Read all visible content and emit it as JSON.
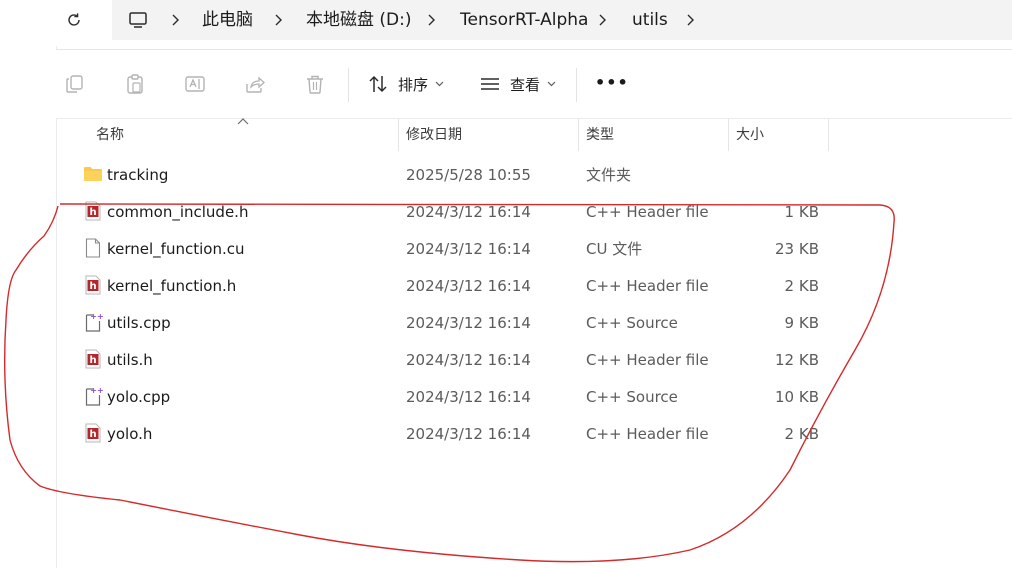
{
  "address_bar": {
    "breadcrumbs": [
      "此电脑",
      "本地磁盘 (D:)",
      "TensorRT-Alpha",
      "utils"
    ]
  },
  "toolbar": {
    "sort_label": "排序",
    "view_label": "查看",
    "more_label": "•••"
  },
  "columns": {
    "name": "名称",
    "date": "修改日期",
    "type": "类型",
    "size": "大小"
  },
  "files": [
    {
      "name": "tracking",
      "date": "2025/5/28 10:55",
      "type": "文件夹",
      "size": "",
      "icon": "folder-icon"
    },
    {
      "name": "common_include.h",
      "date": "2024/3/12 16:14",
      "type": "C++ Header file",
      "size": "1 KB",
      "icon": "header-file-icon"
    },
    {
      "name": "kernel_function.cu",
      "date": "2024/3/12 16:14",
      "type": "CU 文件",
      "size": "23 KB",
      "icon": "blank-file-icon"
    },
    {
      "name": "kernel_function.h",
      "date": "2024/3/12 16:14",
      "type": "C++ Header file",
      "size": "2 KB",
      "icon": "header-file-icon"
    },
    {
      "name": "utils.cpp",
      "date": "2024/3/12 16:14",
      "type": "C++ Source",
      "size": "9 KB",
      "icon": "cpp-file-icon"
    },
    {
      "name": "utils.h",
      "date": "2024/3/12 16:14",
      "type": "C++ Header file",
      "size": "12 KB",
      "icon": "header-file-icon"
    },
    {
      "name": "yolo.cpp",
      "date": "2024/3/12 16:14",
      "type": "C++ Source",
      "size": "10 KB",
      "icon": "cpp-file-icon"
    },
    {
      "name": "yolo.h",
      "date": "2024/3/12 16:14",
      "type": "C++ Header file",
      "size": "2 KB",
      "icon": "header-file-icon"
    }
  ],
  "colors": {
    "annotation": "#d42a2a",
    "folder": "#f8c94a",
    "header_icon": "#b0272d"
  }
}
